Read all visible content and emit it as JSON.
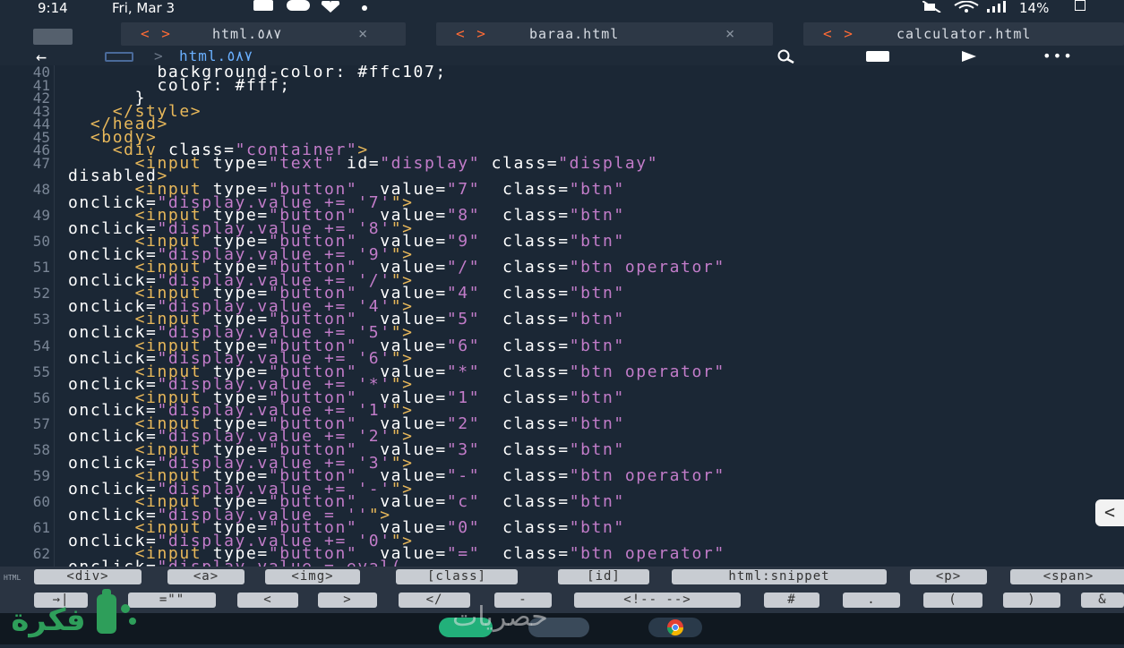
{
  "status": {
    "time": "9:14",
    "date": "Fri, Mar 3",
    "battery": "14%"
  },
  "tabs": [
    {
      "arrows": "< >",
      "name": "html.٥٨٧",
      "close": "×"
    },
    {
      "arrows": "< >",
      "name": "baraa.html",
      "close": "×"
    },
    {
      "arrows": "< >",
      "name": "calculator.html",
      "close": ""
    }
  ],
  "toolbar": {
    "back": "←",
    "breadcrumb_sep": ">",
    "breadcrumb_file": "html.٥٨٧",
    "search_icon": "search-icon",
    "save_icon": "save-icon",
    "run_icon": "play-icon",
    "more_icon": "more-icon",
    "more": "•••"
  },
  "editor": {
    "lines": [
      {
        "n": "40",
        "text": ""
      },
      {
        "n": "41",
        "text": ""
      },
      {
        "n": "42",
        "text": ""
      },
      {
        "n": "43",
        "text": ""
      },
      {
        "n": "44",
        "text": ""
      },
      {
        "n": "45",
        "text": ""
      },
      {
        "n": "46",
        "text": ""
      },
      {
        "n": "47",
        "text": ""
      },
      {
        "n": "",
        "text": ""
      },
      {
        "n": "48",
        "text": ""
      },
      {
        "n": "",
        "text": ""
      },
      {
        "n": "49",
        "text": ""
      },
      {
        "n": "",
        "text": ""
      },
      {
        "n": "50",
        "text": ""
      },
      {
        "n": "",
        "text": ""
      },
      {
        "n": "51",
        "text": ""
      },
      {
        "n": "",
        "text": ""
      },
      {
        "n": "52",
        "text": ""
      },
      {
        "n": "",
        "text": ""
      },
      {
        "n": "53",
        "text": ""
      },
      {
        "n": "",
        "text": ""
      },
      {
        "n": "54",
        "text": ""
      },
      {
        "n": "",
        "text": ""
      },
      {
        "n": "55",
        "text": ""
      },
      {
        "n": "",
        "text": ""
      },
      {
        "n": "56",
        "text": ""
      },
      {
        "n": "",
        "text": ""
      },
      {
        "n": "57",
        "text": ""
      },
      {
        "n": "",
        "text": ""
      },
      {
        "n": "58",
        "text": ""
      },
      {
        "n": "",
        "text": ""
      },
      {
        "n": "59",
        "text": ""
      },
      {
        "n": "",
        "text": ""
      },
      {
        "n": "60",
        "text": ""
      },
      {
        "n": "",
        "text": ""
      },
      {
        "n": "61",
        "text": ""
      },
      {
        "n": "",
        "text": ""
      },
      {
        "n": "62",
        "text": ""
      }
    ],
    "code": {
      "l40": "        background-color: #ffc107;",
      "l41": "        color: #fff;",
      "l42": "      }",
      "l43": "    </style>",
      "l44": "  </head>",
      "l45": "  <body>",
      "l46a": "    <div ",
      "l46b": "class=",
      "l46c": "\"container\"",
      "l46d": ">",
      "l47a": "      <input ",
      "l47b": "type=",
      "l47c": "\"text\" ",
      "l47d": "id=",
      "l47e": "\"display\" ",
      "l47f": "class=",
      "l47g": "\"display\"",
      "l47w": "disabled",
      "l47x": ">"
    },
    "buttons": [
      {
        "v": "7",
        "cls": "btn",
        "click": "display.value += '7'"
      },
      {
        "v": "8",
        "cls": "btn",
        "click": "display.value += '8'"
      },
      {
        "v": "9",
        "cls": "btn",
        "click": "display.value += '9'"
      },
      {
        "v": "/",
        "cls": "btn operator",
        "click": "display.value += '/'"
      },
      {
        "v": "4",
        "cls": "btn",
        "click": "display.value += '4'"
      },
      {
        "v": "5",
        "cls": "btn",
        "click": "display.value += '5'"
      },
      {
        "v": "6",
        "cls": "btn",
        "click": "display.value += '6'"
      },
      {
        "v": "*",
        "cls": "btn operator",
        "click": "display.value += '*'"
      },
      {
        "v": "1",
        "cls": "btn",
        "click": "display.value += '1'"
      },
      {
        "v": "2",
        "cls": "btn",
        "click": "display.value += '2'"
      },
      {
        "v": "3",
        "cls": "btn",
        "click": "display.value += '3'"
      },
      {
        "v": "-",
        "cls": "btn operator",
        "click": "display.value += '-'"
      },
      {
        "v": "c",
        "cls": "btn",
        "click": "display.value = ''"
      },
      {
        "v": "0",
        "cls": "btn",
        "click": "display.value += '0'"
      },
      {
        "v": "=",
        "cls": "btn operator",
        "click": "display.value = eval("
      }
    ]
  },
  "shortcuts_row1": [
    "<div>",
    "<a>",
    "<img>",
    "[class]",
    "[id]",
    "html:snippet",
    "<p>",
    "<span>"
  ],
  "shortcuts_row2": [
    "→|",
    "=\"\"",
    "<",
    ">",
    "</",
    "-",
    "<!-- -->",
    "#",
    ".",
    "(",
    ")",
    "&"
  ],
  "side_label": "HTML",
  "side_toggle": "<",
  "watermark": "فكرة",
  "watermark2": "حصريات",
  "colors": {
    "bg": "#1b2735",
    "tag": "#e8b85a",
    "string": "#c27cc9",
    "arrows": "#ff6b35"
  }
}
